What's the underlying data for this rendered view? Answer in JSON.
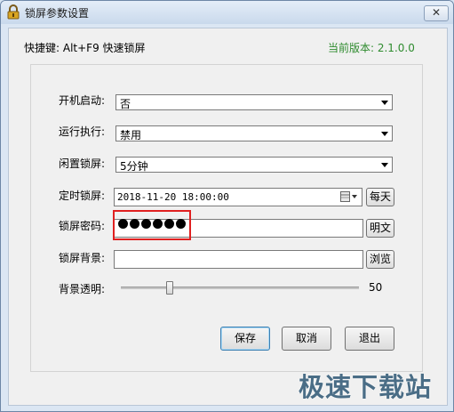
{
  "window": {
    "title": "锁屏参数设置",
    "close_label": "✕"
  },
  "header": {
    "hotkey": "快捷键: Alt+F9 快速锁屏",
    "version": "当前版本: 2.1.0.0"
  },
  "form": {
    "startup": {
      "label": "开机启动:",
      "value": "否"
    },
    "run": {
      "label": "运行执行:",
      "value": "禁用"
    },
    "idle_lock": {
      "label": "闲置锁屏:",
      "value": "5分钟"
    },
    "timed_lock": {
      "label": "定时锁屏:",
      "value": "2018-11-20 18:00:00",
      "repeat_button": "每天"
    },
    "password": {
      "label": "锁屏密码:",
      "masked_count": 6,
      "show_button": "明文"
    },
    "background": {
      "label": "锁屏背景:",
      "value": "",
      "browse_button": "浏览"
    },
    "transparency": {
      "label": "背景透明:",
      "value": "50",
      "level_fraction": 0.2
    }
  },
  "actions": {
    "save": "保存",
    "cancel": "取消",
    "exit": "退出"
  },
  "watermark": "极速下载站",
  "colors": {
    "version_text": "#2e8b2e",
    "highlight_box": "#e02020"
  }
}
